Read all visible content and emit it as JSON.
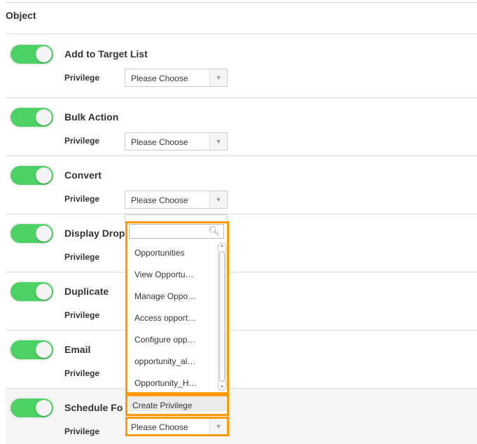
{
  "header": {
    "title": "Object"
  },
  "rows": [
    {
      "title": "Add to Target List",
      "label": "Privilege",
      "value": "Please Choose",
      "enabled": true
    },
    {
      "title": "Bulk Action",
      "label": "Privilege",
      "value": "Please Choose",
      "enabled": true
    },
    {
      "title": "Convert",
      "label": "Privilege",
      "value": "Please Choose",
      "enabled": true
    },
    {
      "title": "Display Drop",
      "label": "Privilege",
      "value": "",
      "enabled": true
    },
    {
      "title": "Duplicate",
      "label": "Privilege",
      "value": "",
      "enabled": true
    },
    {
      "title": "Email",
      "label": "Privilege",
      "value": "",
      "enabled": true
    },
    {
      "title": "Schedule Fo",
      "label": "Privilege",
      "value": "Please Choose",
      "enabled": true
    }
  ],
  "dropdown": {
    "search_placeholder": "",
    "items": [
      "Opportunities",
      "View Opportu…",
      "Manage Oppo…",
      "Access opport…",
      "Configure opp…",
      "opportunity_al…",
      "Opportunity_H…"
    ],
    "create_label": "Create Privilege"
  },
  "colors": {
    "toggle_on": "#4cd264",
    "highlight": "#ff9900"
  }
}
